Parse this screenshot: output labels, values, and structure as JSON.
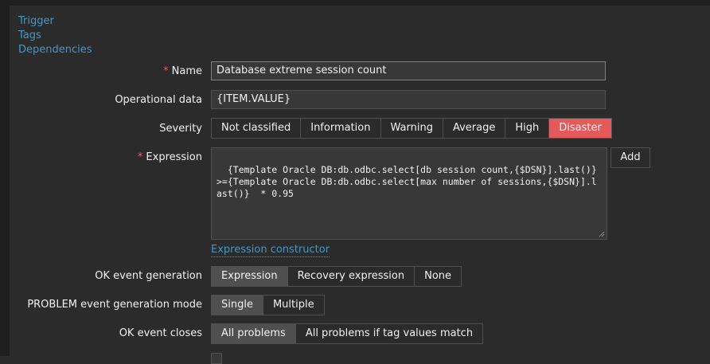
{
  "nav": {
    "tabs": [
      "Trigger",
      "Tags",
      "Dependencies"
    ]
  },
  "form": {
    "name": {
      "label": "Name",
      "value": "Database extreme session count",
      "required": true
    },
    "operational_data": {
      "label": "Operational data",
      "value": "{ITEM.VALUE}"
    },
    "severity": {
      "label": "Severity",
      "options": [
        "Not classified",
        "Information",
        "Warning",
        "Average",
        "High",
        "Disaster"
      ],
      "selected": "Disaster"
    },
    "expression": {
      "label": "Expression",
      "value": "{Template Oracle DB:db.odbc.select[db session count,{$DSN}].last()}>={Template Oracle DB:db.odbc.select[max number of sessions,{$DSN}].last()}  * 0.95",
      "add_label": "Add",
      "constructor_link": "Expression constructor",
      "required": true
    },
    "ok_event_generation": {
      "label": "OK event generation",
      "options": [
        "Expression",
        "Recovery expression",
        "None"
      ],
      "selected": "Expression"
    },
    "problem_event_mode": {
      "label": "PROBLEM event generation mode",
      "options": [
        "Single",
        "Multiple"
      ],
      "selected": "Single"
    },
    "ok_event_closes": {
      "label": "OK event closes",
      "options": [
        "All problems",
        "All problems if tag values match"
      ],
      "selected": "All problems"
    }
  },
  "colors": {
    "background": "#2b2b2b",
    "link": "#4796c4",
    "required_star": "#e45959",
    "disaster": "#e45959",
    "active_segment": "#4f4f4f"
  }
}
